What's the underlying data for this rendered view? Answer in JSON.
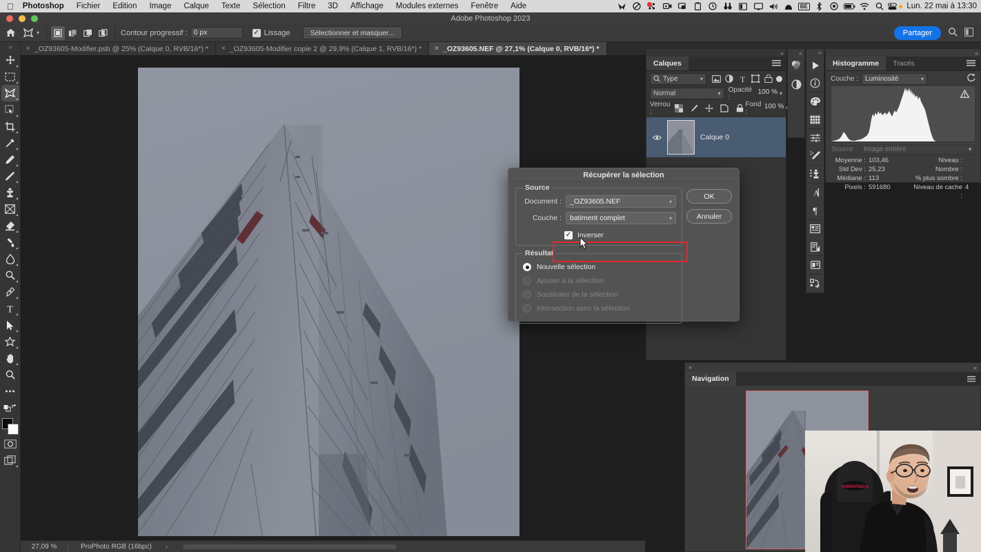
{
  "macos": {
    "apple_icon": "apple-icon",
    "app_name": "Photoshop",
    "menus": [
      "Fichier",
      "Edition",
      "Image",
      "Calque",
      "Texte",
      "Sélection",
      "Filtre",
      "3D",
      "Affichage",
      "Modules externes",
      "Fenêtre",
      "Aide"
    ],
    "status_icons": [
      "bird-icon",
      "do-not-disturb-icon",
      "notification-icon",
      "screen-record-icon",
      "airplay-icon",
      "clipboard-icon",
      "time-machine-icon",
      "binoculars-icon",
      "split-view-icon",
      "display-icon",
      "volume-icon",
      "arc-icon",
      "be-input-icon",
      "bluetooth-icon",
      "target-icon",
      "battery-icon",
      "wifi-icon",
      "spotlight-icon",
      "control-center-icon"
    ],
    "clock": "Lun. 22 mai à 13:30"
  },
  "window": {
    "title": "Adobe Photoshop 2023",
    "traffic_lights": [
      "close-button",
      "minimize-button",
      "maximize-button"
    ]
  },
  "options_bar": {
    "home_icon": "home-icon",
    "tool_icon": "lasso-polygonal-icon",
    "selection_modes": [
      "new-selection",
      "add-to-selection",
      "subtract-from-selection",
      "intersect-selection"
    ],
    "feather_label": "Contour progressif :",
    "feather_value": "0 px",
    "antialias_label": "Lissage",
    "antialias_checked": true,
    "select_mask_button": "Sélectionner et masquer...",
    "share_button": "Partager",
    "right_icons": [
      "search-icon",
      "workspace-icon"
    ]
  },
  "tabs": [
    {
      "name": "_OZ93605-Modifier.psb @ 25% (Calque 0, RVB/16*) *",
      "active": false
    },
    {
      "name": "_OZ93605-Modifier copie 2 @ 29,9% (Calque 1, RVB/16*) *",
      "active": false
    },
    {
      "name": "_OZ93605.NEF @ 27,1% (Calque 0, RVB/16*) *",
      "active": true
    }
  ],
  "toolbar": {
    "handle": "»",
    "tools": [
      "move-tool",
      "rectangular-marquee-tool",
      "lasso-tool",
      "object-selection-tool",
      "crop-tool",
      "eyedropper-tool",
      "spot-healing-brush-tool",
      "brush-tool",
      "clone-stamp-tool",
      "history-brush-tool",
      "eraser-tool",
      "gradient-tool",
      "blur-tool",
      "dodge-tool",
      "pen-tool",
      "type-tool",
      "path-selection-tool",
      "shape-tool",
      "hand-tool",
      "zoom-tool",
      "edit-toolbar-tool"
    ],
    "active_tool": "lasso-tool",
    "quick_mask": "quick-mask-icon",
    "screen_mode": "screen-mode-icon",
    "foreground_color": "#000000",
    "background_color": "#ffffff"
  },
  "status_bar": {
    "zoom": "27,09 %",
    "color_profile": "ProPhoto RGB (16bpc)",
    "arrow": "›"
  },
  "layers_panel": {
    "tab_label": "Calques",
    "menu_icon": "panel-menu-icon",
    "collapse_icon": "»",
    "filter_label": "Type",
    "filter_icon": "search-icon",
    "filter_type_icons": [
      "pixel-filter-icon",
      "adjustment-filter-icon",
      "type-filter-icon",
      "shape-filter-icon",
      "smart-object-filter-icon"
    ],
    "filter_toggle": "filter-toggle",
    "blend_mode": "Normal",
    "opacity_label": "Opacité :",
    "opacity_value": "100 %",
    "lock_label": "Verrou :",
    "lock_icons": [
      "lock-transparent-icon",
      "lock-image-icon",
      "lock-position-icon",
      "lock-artboard-icon",
      "lock-all-icon"
    ],
    "fill_label": "Fond :",
    "fill_value": "100 %",
    "layers": [
      {
        "name": "Calque 0",
        "visible": true,
        "selected": true
      }
    ]
  },
  "icon_rails": {
    "rail_a": [
      "color-wheel-icon",
      "adjustments-icon"
    ],
    "rail_b": [
      "libraries-icon",
      "info-icon",
      "color-icon",
      "swatches-icon",
      "adjustments-panel-icon",
      "brush-settings-icon",
      "clone-source-icon",
      "character-icon",
      "paragraph-icon",
      "character-styles-icon",
      "paragraph-styles-icon",
      "layer-comps-icon",
      "actions-icon"
    ]
  },
  "histogram_panel": {
    "tabs": [
      {
        "label": "Histogramme",
        "active": true
      },
      {
        "label": "Tracés",
        "active": false
      }
    ],
    "menu_icon": "panel-menu-icon",
    "collapse_icon": "«",
    "channel_label": "Couche :",
    "channel_value": "Luminosité",
    "refresh_icon": "refresh-icon",
    "warning_icon": "warning-triangle-icon",
    "source_label": "Source :",
    "source_value": "Image entière",
    "stats": [
      {
        "label": "Moyenne :",
        "value": "103,46"
      },
      {
        "label": "Std Dev :",
        "value": "25,23"
      },
      {
        "label": "Médiane :",
        "value": "113"
      },
      {
        "label": "Pixels :",
        "value": "591680"
      }
    ],
    "stats_right": [
      {
        "label": "Niveau :",
        "value": ""
      },
      {
        "label": "Nombre :",
        "value": ""
      },
      {
        "label": "% plus sombre :",
        "value": ""
      },
      {
        "label": "Niveau de cache :",
        "value": "4"
      }
    ]
  },
  "navigation_panel": {
    "tab_label": "Navigation",
    "close_icon": "×",
    "collapse_icon": "«",
    "menu_icon": "panel-menu-icon",
    "view_box_color": "#d46a6a"
  },
  "dialog": {
    "title": "Récupérer la sélection",
    "source_legend": "Source",
    "document_label": "Document :",
    "document_value": "_OZ93605.NEF",
    "channel_label": "Couche :",
    "channel_value": "batiment complet",
    "invert_label": "Inverser",
    "invert_checked": true,
    "result_legend": "Résultat",
    "result_options": [
      {
        "label": "Nouvelle sélection",
        "selected": true,
        "disabled": false
      },
      {
        "label": "Ajouter à la sélection",
        "selected": false,
        "disabled": true
      },
      {
        "label": "Soustraire de la sélection",
        "selected": false,
        "disabled": true
      },
      {
        "label": "Intersection avec la sélection",
        "selected": false,
        "disabled": true
      }
    ],
    "ok_button": "OK",
    "cancel_button": "Annuler",
    "highlight_color": "#e5262b"
  },
  "cursor": {
    "type": "arrow-cursor"
  }
}
